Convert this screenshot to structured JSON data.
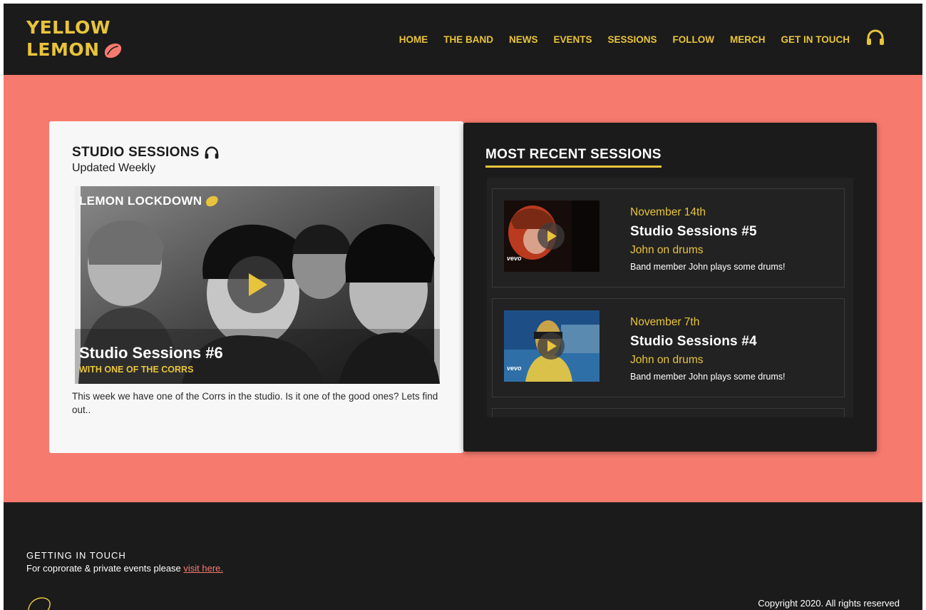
{
  "colors": {
    "accent": "#e8c43c",
    "salmon": "#f67a6e",
    "dark": "#1b1b1b"
  },
  "header": {
    "logo_line1": "YELLOW",
    "logo_line2": "LEMON",
    "nav": [
      "HOME",
      "THE BAND",
      "NEWS",
      "EVENTS",
      "SESSIONS",
      "FOLLOW",
      "MERCH",
      "GET IN TOUCH"
    ],
    "nav_icon": "headphones-icon"
  },
  "studio": {
    "title": "STUDIO SESSIONS",
    "subtitle": "Updated Weekly",
    "feature": {
      "tag": "LEMON LOCKDOWN",
      "title": "Studio Sessions #6",
      "subtitle": "WITH ONE OF THE CORRS"
    },
    "description": "This week we have one of the Corrs in the studio. Is it one of the good ones? Lets find out.."
  },
  "recent": {
    "title": "MOST RECENT SESSIONS",
    "items": [
      {
        "date": "November 14th",
        "name": "Studio Sessions #5",
        "who": "John on drums",
        "blurb": "Band member John plays some drums!",
        "thumb_label": "vevo"
      },
      {
        "date": "November 7th",
        "name": "Studio Sessions #4",
        "who": "John on drums",
        "blurb": "Band member John plays some drums!",
        "thumb_label": "vevo"
      }
    ]
  },
  "footer": {
    "heading": "GETTING IN TOUCH",
    "text": "For coprorate & private events please ",
    "link": "visit here.",
    "copyright": "Copyright 2020. All rights reserved"
  }
}
